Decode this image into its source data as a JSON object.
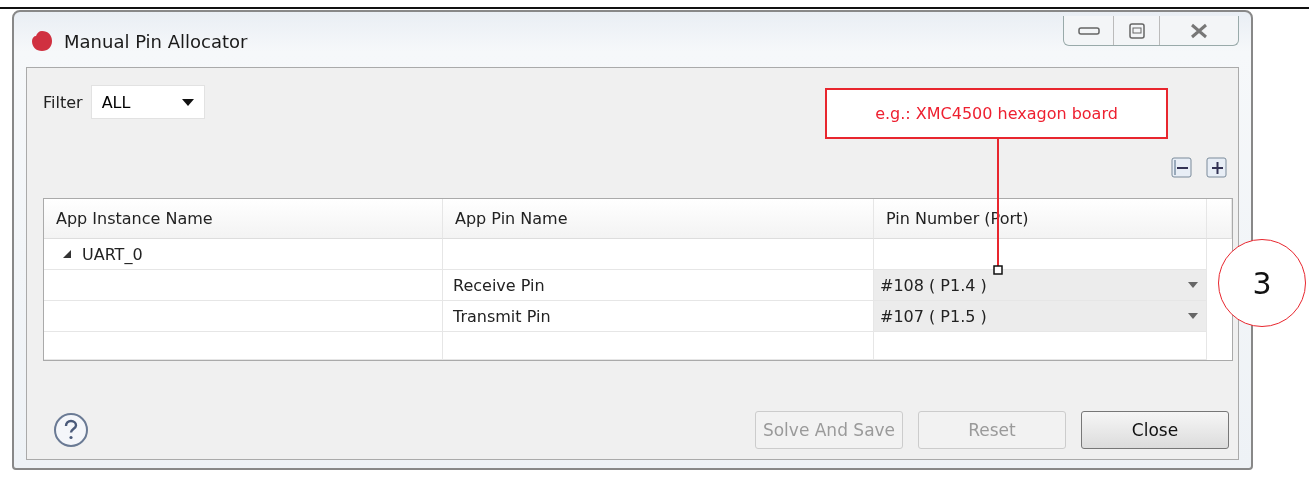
{
  "window": {
    "title": "Manual Pin Allocator"
  },
  "filter": {
    "label": "Filter",
    "value": "ALL"
  },
  "table": {
    "columns": [
      "App Instance Name",
      "App Pin Name",
      "Pin Number (Port)"
    ],
    "rows": [
      {
        "instance": "UART_0",
        "expanded": true,
        "children": [
          {
            "pin_name": "Receive Pin",
            "pin_number": "#108 ( P1.4 )"
          },
          {
            "pin_name": "Transmit Pin",
            "pin_number": "#107 ( P1.5 )"
          }
        ]
      }
    ]
  },
  "buttons": [
    {
      "label": "Solve And Save",
      "disabled": true
    },
    {
      "label": "Reset",
      "disabled": true
    },
    {
      "label": "Close",
      "disabled": false
    }
  ],
  "annotations": {
    "callout": "e.g.: XMC4500 hexagon board",
    "step_number": "3"
  }
}
